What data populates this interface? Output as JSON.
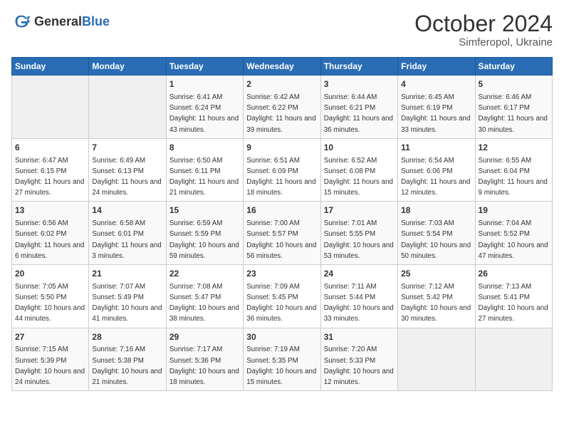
{
  "logo": {
    "text_general": "General",
    "text_blue": "Blue"
  },
  "header": {
    "month": "October 2024",
    "location": "Simferopol, Ukraine"
  },
  "weekdays": [
    "Sunday",
    "Monday",
    "Tuesday",
    "Wednesday",
    "Thursday",
    "Friday",
    "Saturday"
  ],
  "weeks": [
    [
      {
        "day": "",
        "empty": true
      },
      {
        "day": "",
        "empty": true
      },
      {
        "day": "1",
        "sunrise": "6:41 AM",
        "sunset": "6:24 PM",
        "daylight": "11 hours and 43 minutes."
      },
      {
        "day": "2",
        "sunrise": "6:42 AM",
        "sunset": "6:22 PM",
        "daylight": "11 hours and 39 minutes."
      },
      {
        "day": "3",
        "sunrise": "6:44 AM",
        "sunset": "6:21 PM",
        "daylight": "11 hours and 36 minutes."
      },
      {
        "day": "4",
        "sunrise": "6:45 AM",
        "sunset": "6:19 PM",
        "daylight": "11 hours and 33 minutes."
      },
      {
        "day": "5",
        "sunrise": "6:46 AM",
        "sunset": "6:17 PM",
        "daylight": "11 hours and 30 minutes."
      }
    ],
    [
      {
        "day": "6",
        "sunrise": "6:47 AM",
        "sunset": "6:15 PM",
        "daylight": "11 hours and 27 minutes."
      },
      {
        "day": "7",
        "sunrise": "6:49 AM",
        "sunset": "6:13 PM",
        "daylight": "11 hours and 24 minutes."
      },
      {
        "day": "8",
        "sunrise": "6:50 AM",
        "sunset": "6:11 PM",
        "daylight": "11 hours and 21 minutes."
      },
      {
        "day": "9",
        "sunrise": "6:51 AM",
        "sunset": "6:09 PM",
        "daylight": "11 hours and 18 minutes."
      },
      {
        "day": "10",
        "sunrise": "6:52 AM",
        "sunset": "6:08 PM",
        "daylight": "11 hours and 15 minutes."
      },
      {
        "day": "11",
        "sunrise": "6:54 AM",
        "sunset": "6:06 PM",
        "daylight": "11 hours and 12 minutes."
      },
      {
        "day": "12",
        "sunrise": "6:55 AM",
        "sunset": "6:04 PM",
        "daylight": "11 hours and 9 minutes."
      }
    ],
    [
      {
        "day": "13",
        "sunrise": "6:56 AM",
        "sunset": "6:02 PM",
        "daylight": "11 hours and 6 minutes."
      },
      {
        "day": "14",
        "sunrise": "6:58 AM",
        "sunset": "6:01 PM",
        "daylight": "11 hours and 3 minutes."
      },
      {
        "day": "15",
        "sunrise": "6:59 AM",
        "sunset": "5:59 PM",
        "daylight": "10 hours and 59 minutes."
      },
      {
        "day": "16",
        "sunrise": "7:00 AM",
        "sunset": "5:57 PM",
        "daylight": "10 hours and 56 minutes."
      },
      {
        "day": "17",
        "sunrise": "7:01 AM",
        "sunset": "5:55 PM",
        "daylight": "10 hours and 53 minutes."
      },
      {
        "day": "18",
        "sunrise": "7:03 AM",
        "sunset": "5:54 PM",
        "daylight": "10 hours and 50 minutes."
      },
      {
        "day": "19",
        "sunrise": "7:04 AM",
        "sunset": "5:52 PM",
        "daylight": "10 hours and 47 minutes."
      }
    ],
    [
      {
        "day": "20",
        "sunrise": "7:05 AM",
        "sunset": "5:50 PM",
        "daylight": "10 hours and 44 minutes."
      },
      {
        "day": "21",
        "sunrise": "7:07 AM",
        "sunset": "5:49 PM",
        "daylight": "10 hours and 41 minutes."
      },
      {
        "day": "22",
        "sunrise": "7:08 AM",
        "sunset": "5:47 PM",
        "daylight": "10 hours and 38 minutes."
      },
      {
        "day": "23",
        "sunrise": "7:09 AM",
        "sunset": "5:45 PM",
        "daylight": "10 hours and 36 minutes."
      },
      {
        "day": "24",
        "sunrise": "7:11 AM",
        "sunset": "5:44 PM",
        "daylight": "10 hours and 33 minutes."
      },
      {
        "day": "25",
        "sunrise": "7:12 AM",
        "sunset": "5:42 PM",
        "daylight": "10 hours and 30 minutes."
      },
      {
        "day": "26",
        "sunrise": "7:13 AM",
        "sunset": "5:41 PM",
        "daylight": "10 hours and 27 minutes."
      }
    ],
    [
      {
        "day": "27",
        "sunrise": "7:15 AM",
        "sunset": "5:39 PM",
        "daylight": "10 hours and 24 minutes."
      },
      {
        "day": "28",
        "sunrise": "7:16 AM",
        "sunset": "5:38 PM",
        "daylight": "10 hours and 21 minutes."
      },
      {
        "day": "29",
        "sunrise": "7:17 AM",
        "sunset": "5:36 PM",
        "daylight": "10 hours and 18 minutes."
      },
      {
        "day": "30",
        "sunrise": "7:19 AM",
        "sunset": "5:35 PM",
        "daylight": "10 hours and 15 minutes."
      },
      {
        "day": "31",
        "sunrise": "7:20 AM",
        "sunset": "5:33 PM",
        "daylight": "10 hours and 12 minutes."
      },
      {
        "day": "",
        "empty": true
      },
      {
        "day": "",
        "empty": true
      }
    ]
  ],
  "labels": {
    "sunrise": "Sunrise:",
    "sunset": "Sunset:",
    "daylight": "Daylight:"
  }
}
